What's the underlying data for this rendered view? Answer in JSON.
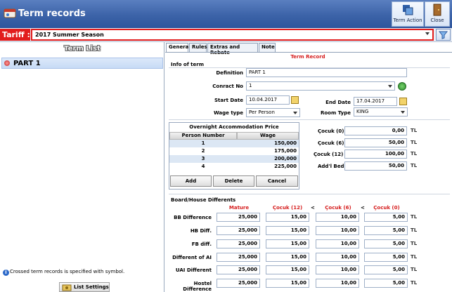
{
  "window": {
    "title": "Term records"
  },
  "toolbar": {
    "term_action_label": "Term Action",
    "close_label": "Close"
  },
  "tariff": {
    "label": "Tariff :",
    "value": "2017 Summer Season"
  },
  "left": {
    "title": "Term List",
    "items": [
      {
        "label": "PART 1"
      }
    ],
    "footer_info": "Crossed term records is specified with symbol.",
    "list_settings": "List Settings"
  },
  "tabs": [
    "General",
    "Rules",
    "Extras and Rebate",
    "Note"
  ],
  "record": {
    "title": "Term Record",
    "info_section": "Info of term",
    "definition_label": "Definition",
    "definition_value": "PART 1",
    "contract_label": "Conract No",
    "contract_value": "1",
    "start_label": "Start Date",
    "start_value": "10.04.2017",
    "end_label": "End Date",
    "end_value": "17.04.2017",
    "wage_label": "Wage type",
    "wage_value": "Per Person",
    "room_label": "Room Type",
    "room_value": "KING"
  },
  "price_table": {
    "title": "Overnight Accommodation Price",
    "headers": [
      "Person Number",
      "Wage"
    ],
    "rows": [
      {
        "n": "1",
        "w": "150,000"
      },
      {
        "n": "2",
        "w": "175,000"
      },
      {
        "n": "3",
        "w": "200,000"
      },
      {
        "n": "4",
        "w": "225,000"
      }
    ],
    "add": "Add",
    "delete": "Delete",
    "cancel": "Cancel"
  },
  "child": {
    "c0_label": "Çocuk (0)",
    "c0_value": "0,00",
    "c6_label": "Çocuk (6)",
    "c6_value": "50,00",
    "c12_label": "Çocuk (12)",
    "c12_value": "100,00",
    "bed_label": "Add'l Bed",
    "bed_value": "50,00"
  },
  "board": {
    "section": "Board/House Differents",
    "headers": [
      "Mature",
      "Çocuk (12)",
      "Çocuk (6)",
      "Çocuk (0)"
    ],
    "lt": "<",
    "rows": [
      {
        "label": "BB Difference",
        "v": [
          "25,000",
          "15,00",
          "10,00",
          "5,00"
        ]
      },
      {
        "label": "HB Diff.",
        "v": [
          "25,000",
          "15,00",
          "10,00",
          "5,00"
        ]
      },
      {
        "label": "FB diff.",
        "v": [
          "25,000",
          "15,00",
          "10,00",
          "5,00"
        ]
      },
      {
        "label": "Different of AI",
        "v": [
          "25,000",
          "15,00",
          "10,00",
          "5,00"
        ]
      },
      {
        "label": "UAI Different",
        "v": [
          "25,000",
          "15,00",
          "10,00",
          "5,00"
        ]
      },
      {
        "label": "Hostel Difference",
        "v": [
          "25,000",
          "15,00",
          "10,00",
          "5,00"
        ]
      }
    ]
  },
  "currency_icon": "TL",
  "colors": {
    "tariff_red": "#e21d1d",
    "title_blue": "#3c63a8",
    "header_red": "#d62020"
  }
}
